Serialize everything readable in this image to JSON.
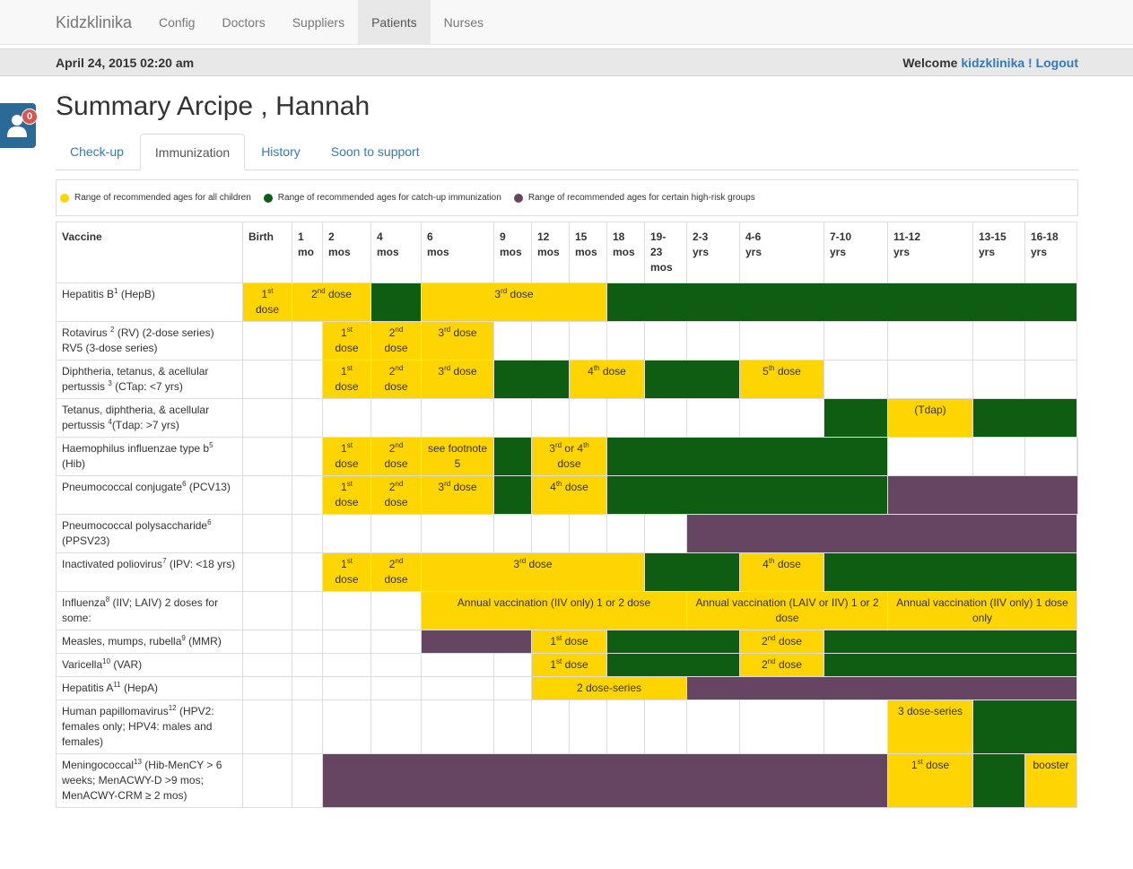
{
  "app": {
    "brand": "Kidzklinika",
    "nav": [
      "Config",
      "Doctors",
      "Suppliers",
      "Patients",
      "Nurses"
    ],
    "active_nav": "Patients"
  },
  "subbar": {
    "date": "April 24, 2015 02:20 am",
    "welcome": "Welcome",
    "user": "kidzklinika !",
    "logout": "Logout"
  },
  "notifications": {
    "count": "0",
    "icon": "user-icon"
  },
  "page": {
    "title": "Summary Arcipe , Hannah",
    "tabs": [
      "Check-up",
      "Immunization",
      "History",
      "Soon to support"
    ],
    "active_tab": "Immunization"
  },
  "colors": {
    "yellow": "#ffd500",
    "green": "#0f5d12",
    "purple": "#664562",
    "link": "#337ab7"
  },
  "legend": [
    {
      "color": "#ffd500",
      "label": "Range of recommended ages for all children"
    },
    {
      "color": "#0f5d12",
      "label": "Range of recommended ages for catch-up immunization"
    },
    {
      "color": "#664562",
      "label": "Range of recommended ages for certain high-risk groups"
    }
  ],
  "table": {
    "headers": [
      [
        "Vaccine"
      ],
      [
        "Birth"
      ],
      [
        "1",
        "mo"
      ],
      [
        "2",
        "mos"
      ],
      [
        "4",
        "mos"
      ],
      [
        "6",
        "mos"
      ],
      [
        "9",
        "mos"
      ],
      [
        "12",
        "mos"
      ],
      [
        "15",
        "mos"
      ],
      [
        "18",
        "mos"
      ],
      [
        "19-",
        "23",
        "mos"
      ],
      [
        "2-3",
        "yrs"
      ],
      [
        "4-6",
        "yrs"
      ],
      [
        "7-10",
        "yrs"
      ],
      [
        "11-12",
        "yrs"
      ],
      [
        "13-15",
        "yrs"
      ],
      [
        "16-18",
        "yrs"
      ]
    ],
    "rows": [
      {
        "vaccine": [
          "Hepatitis B",
          "1",
          " (HepB)"
        ],
        "cells": [
          [
            "y",
            1,
            [
              "1",
              "st",
              " dose"
            ]
          ],
          [
            "y",
            2,
            [
              "2",
              "nd",
              " dose"
            ]
          ],
          [
            "g",
            1
          ],
          [
            "y",
            4,
            [
              "3",
              "rd",
              " dose"
            ]
          ],
          [
            "g",
            8
          ]
        ]
      },
      {
        "vaccine": [
          "Rotavirus ",
          "2",
          " (RV) (2-dose series) RV5 (3-dose series)"
        ],
        "cells": [
          [
            "w",
            1
          ],
          [
            "w",
            1
          ],
          [
            "y",
            1,
            [
              "1",
              "st",
              " dose"
            ]
          ],
          [
            "y",
            1,
            [
              "2",
              "nd",
              " dose"
            ]
          ],
          [
            "y",
            1,
            [
              "3",
              "rd",
              " dose"
            ]
          ],
          [
            "w",
            1
          ],
          [
            "w",
            1
          ],
          [
            "w",
            1
          ],
          [
            "w",
            1
          ],
          [
            "w",
            1
          ],
          [
            "w",
            1
          ],
          [
            "w",
            1
          ],
          [
            "w",
            1
          ],
          [
            "w",
            1
          ],
          [
            "w",
            1
          ],
          [
            "w",
            1
          ]
        ]
      },
      {
        "vaccine": [
          "Diphtheria, tetanus, & acellular pertussis ",
          "3",
          " (CTap: <7 yrs)"
        ],
        "cells": [
          [
            "w",
            1
          ],
          [
            "w",
            1
          ],
          [
            "y",
            1,
            [
              "1",
              "st",
              " dose"
            ]
          ],
          [
            "y",
            1,
            [
              "2",
              "nd",
              " dose"
            ]
          ],
          [
            "y",
            1,
            [
              "3",
              "rd",
              " dose"
            ]
          ],
          [
            "g",
            2
          ],
          [
            "y",
            2,
            [
              "4",
              "th",
              " dose"
            ]
          ],
          [
            "g",
            2
          ],
          [
            "y",
            1,
            [
              "5",
              "th",
              " dose"
            ]
          ],
          [
            "w",
            1
          ],
          [
            "w",
            1
          ],
          [
            "w",
            1
          ],
          [
            "w",
            1
          ]
        ]
      },
      {
        "vaccine": [
          "Tetanus, diphtheria, & acellular pertussis ",
          "4",
          "(Tdap: >7 yrs)"
        ],
        "cells": [
          [
            "w",
            1
          ],
          [
            "w",
            1
          ],
          [
            "w",
            1
          ],
          [
            "w",
            1
          ],
          [
            "w",
            1
          ],
          [
            "w",
            1
          ],
          [
            "w",
            1
          ],
          [
            "w",
            1
          ],
          [
            "w",
            1
          ],
          [
            "w",
            1
          ],
          [
            "w",
            1
          ],
          [
            "w",
            1
          ],
          [
            "g",
            1
          ],
          [
            "y",
            1,
            [
              "(Tdap)"
            ]
          ],
          [
            "g",
            2
          ]
        ]
      },
      {
        "vaccine": [
          "Haemophilus influenzae type b",
          "5",
          " (Hib)"
        ],
        "cells": [
          [
            "w",
            1
          ],
          [
            "w",
            1
          ],
          [
            "y",
            1,
            [
              "1",
              "st",
              " dose"
            ]
          ],
          [
            "y",
            1,
            [
              "2",
              "nd",
              " dose"
            ]
          ],
          [
            "y",
            1,
            [
              "see footnote 5"
            ]
          ],
          [
            "g",
            1
          ],
          [
            "y",
            2,
            [
              "3",
              "rd",
              " or 4",
              "th",
              " dose"
            ]
          ],
          [
            "g",
            5
          ],
          [
            "w",
            1
          ],
          [
            "w",
            1
          ],
          [
            "w",
            1
          ],
          [
            "w",
            1
          ]
        ]
      },
      {
        "vaccine": [
          "Pneumococcal conjugate",
          "6",
          " (PCV13)"
        ],
        "cells": [
          [
            "w",
            1
          ],
          [
            "w",
            1
          ],
          [
            "y",
            1,
            [
              "1",
              "st",
              " dose"
            ]
          ],
          [
            "y",
            1,
            [
              "2",
              "nd",
              " dose"
            ]
          ],
          [
            "y",
            1,
            [
              "3",
              "rd",
              " dose"
            ]
          ],
          [
            "g",
            1
          ],
          [
            "y",
            2,
            [
              "4",
              "th",
              " dose"
            ]
          ],
          [
            "g",
            5
          ],
          [
            "p",
            4
          ]
        ]
      },
      {
        "vaccine": [
          "Pneumococcal polysaccharide",
          "6",
          " (PPSV23)"
        ],
        "cells": [
          [
            "w",
            1
          ],
          [
            "w",
            1
          ],
          [
            "w",
            1
          ],
          [
            "w",
            1
          ],
          [
            "w",
            1
          ],
          [
            "w",
            1
          ],
          [
            "w",
            1
          ],
          [
            "w",
            1
          ],
          [
            "w",
            1
          ],
          [
            "w",
            1
          ],
          [
            "p",
            6
          ]
        ]
      },
      {
        "vaccine": [
          "Inactivated poliovirus",
          "7",
          " (IPV: <18 yrs)"
        ],
        "cells": [
          [
            "w",
            1
          ],
          [
            "w",
            1
          ],
          [
            "y",
            1,
            [
              "1",
              "st",
              " dose"
            ]
          ],
          [
            "y",
            1,
            [
              "2",
              "nd",
              " dose"
            ]
          ],
          [
            "y",
            5,
            [
              "3",
              "rd",
              " dose"
            ]
          ],
          [
            "g",
            2
          ],
          [
            "y",
            1,
            [
              "4",
              "th",
              " dose"
            ]
          ],
          [
            "g",
            4
          ]
        ]
      },
      {
        "vaccine": [
          "Influenza",
          "8",
          " (IIV; LAIV) 2 doses for some:"
        ],
        "cells": [
          [
            "w",
            1
          ],
          [
            "w",
            1
          ],
          [
            "w",
            1
          ],
          [
            "w",
            1
          ],
          [
            "y",
            6,
            [
              "Annual vaccination (IIV only) 1 or 2 dose"
            ]
          ],
          [
            "y",
            3,
            [
              "Annual vaccination (LAIV or IIV) 1 or 2 dose"
            ]
          ],
          [
            "y",
            3,
            [
              "Annual vaccination (IIV only) 1 dose only"
            ]
          ]
        ]
      },
      {
        "vaccine": [
          "Measles, mumps, rubella",
          "9",
          " (MMR)"
        ],
        "cells": [
          [
            "w",
            1
          ],
          [
            "w",
            1
          ],
          [
            "w",
            1
          ],
          [
            "w",
            1
          ],
          [
            "p",
            2
          ],
          [
            "y",
            2,
            [
              "1",
              "st",
              " dose"
            ]
          ],
          [
            "g",
            3
          ],
          [
            "y",
            1,
            [
              "2",
              "nd",
              " dose"
            ]
          ],
          [
            "g",
            4
          ]
        ]
      },
      {
        "vaccine": [
          "Varicella",
          "10",
          " (VAR)"
        ],
        "cells": [
          [
            "w",
            1
          ],
          [
            "w",
            1
          ],
          [
            "w",
            1
          ],
          [
            "w",
            1
          ],
          [
            "w",
            1
          ],
          [
            "w",
            1
          ],
          [
            "y",
            2,
            [
              "1",
              "st",
              " dose"
            ]
          ],
          [
            "g",
            3
          ],
          [
            "y",
            1,
            [
              "2",
              "nd",
              " dose"
            ]
          ],
          [
            "g",
            4
          ]
        ]
      },
      {
        "vaccine": [
          "Hepatitis A",
          "11",
          " (HepA)"
        ],
        "cells": [
          [
            "w",
            1
          ],
          [
            "w",
            1
          ],
          [
            "w",
            1
          ],
          [
            "w",
            1
          ],
          [
            "w",
            1
          ],
          [
            "w",
            1
          ],
          [
            "y",
            4,
            [
              "2 dose-series"
            ]
          ],
          [
            "p",
            6
          ]
        ]
      },
      {
        "vaccine": [
          "Human papillomavirus",
          "12",
          " (HPV2: females only; HPV4: males and females)"
        ],
        "cells": [
          [
            "w",
            1
          ],
          [
            "w",
            1
          ],
          [
            "w",
            1
          ],
          [
            "w",
            1
          ],
          [
            "w",
            1
          ],
          [
            "w",
            1
          ],
          [
            "w",
            1
          ],
          [
            "w",
            1
          ],
          [
            "w",
            1
          ],
          [
            "w",
            1
          ],
          [
            "w",
            1
          ],
          [
            "w",
            1
          ],
          [
            "w",
            1
          ],
          [
            "y",
            1,
            [
              "3 dose-series"
            ]
          ],
          [
            "g",
            2
          ]
        ]
      },
      {
        "vaccine": [
          "Meningococcal",
          "13",
          " (Hib-MenCY > 6 weeks; MenACWY-D >9 mos; MenACWY-CRM ≥ 2 mos)"
        ],
        "cells": [
          [
            "w",
            1
          ],
          [
            "w",
            1
          ],
          [
            "p",
            11
          ],
          [
            "y",
            1,
            [
              "1",
              "st",
              " dose"
            ]
          ],
          [
            "g",
            1
          ],
          [
            "y",
            1,
            [
              "booster"
            ]
          ]
        ]
      }
    ]
  }
}
